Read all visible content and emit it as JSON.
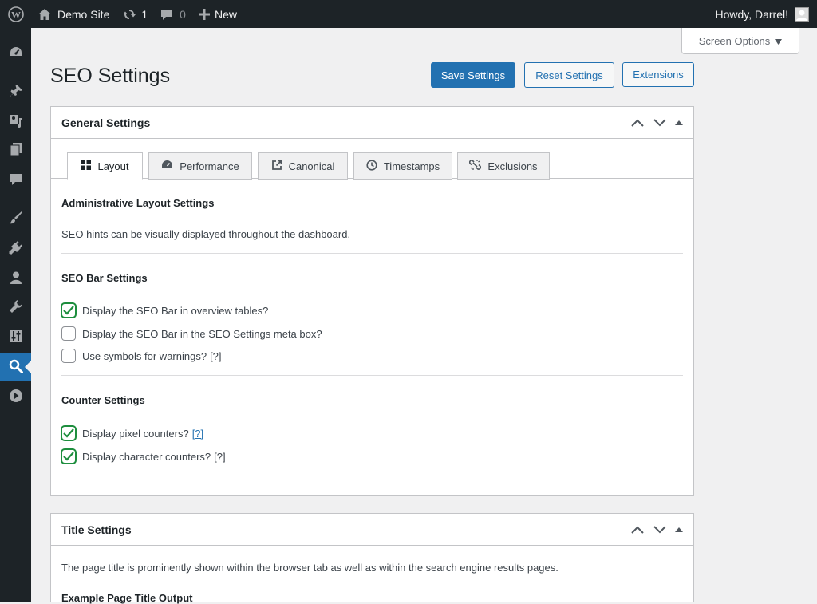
{
  "adminbar": {
    "site_name": "Demo Site",
    "updates_count": "1",
    "comments_count": "0",
    "new_label": "New",
    "greeting": "Howdy, Darrel!"
  },
  "screen_options": {
    "label": "Screen Options"
  },
  "page": {
    "title": "SEO Settings",
    "save_label": "Save Settings",
    "reset_label": "Reset Settings",
    "extensions_label": "Extensions"
  },
  "general": {
    "title": "General Settings",
    "tabs": [
      {
        "label": "Layout",
        "icon": "layout-grid-icon",
        "active": true
      },
      {
        "label": "Performance",
        "icon": "dashboard-gauge-icon"
      },
      {
        "label": "Canonical",
        "icon": "external-link-icon"
      },
      {
        "label": "Timestamps",
        "icon": "clock-icon"
      },
      {
        "label": "Exclusions",
        "icon": "unlink-icon"
      }
    ],
    "admin_layout_title": "Administrative Layout Settings",
    "admin_layout_desc": "SEO hints can be visually displayed throughout the dashboard.",
    "seo_bar_title": "SEO Bar Settings",
    "seo_bar_options": [
      {
        "label": "Display the SEO Bar in overview tables?",
        "checked": true
      },
      {
        "label": "Display the SEO Bar in the SEO Settings meta box?",
        "checked": false
      },
      {
        "label": "Use symbols for warnings?",
        "help": "[?]",
        "checked": false
      }
    ],
    "counter_title": "Counter Settings",
    "counter_options": [
      {
        "label": "Display pixel counters?",
        "help": "[?]",
        "checked": true
      },
      {
        "label": "Display character counters?",
        "help": "[?]",
        "checked": true
      }
    ]
  },
  "title_settings": {
    "title": "Title Settings",
    "desc": "The page title is prominently shown within the browser tab as well as within the search engine results pages.",
    "example_heading": "Example Page Title Output"
  },
  "colors": {
    "primary": "#2271b1",
    "admin_dark": "#1d2327",
    "check_green": "#1e8e3e"
  }
}
